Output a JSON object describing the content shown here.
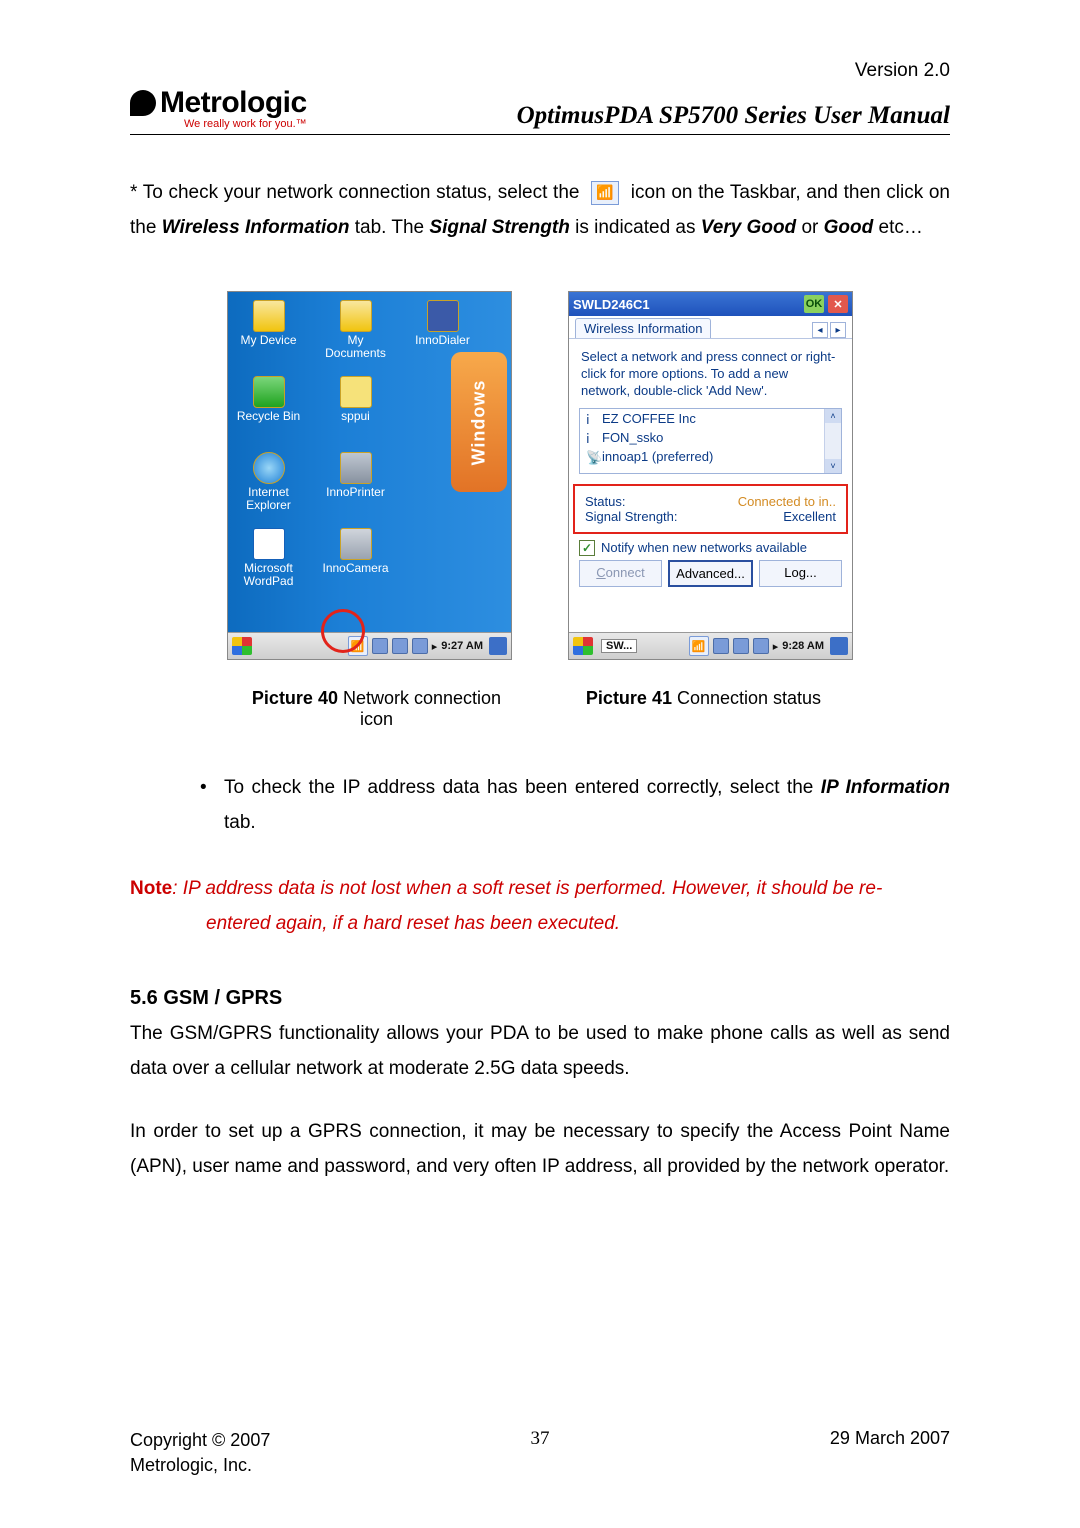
{
  "version_label": "Version 2.0",
  "logo": {
    "name": "Metrologic",
    "tagline": "We really work for you.™"
  },
  "doc_title": "OptimusPDA SP5700 Series User Manual",
  "para1": {
    "t1": "*  To check your network connection status, select the ",
    "t2": " icon on the Taskbar, and then click on the ",
    "wi": "Wireless Information",
    "t3": " tab. The ",
    "ss": "Signal Strength",
    "t4": " is indicated as ",
    "vg": "Very Good",
    "t5": " or ",
    "gd": "Good",
    "t6": " etc…"
  },
  "desktop": {
    "icons": [
      "My Device",
      "My Documents",
      "InnoDialer",
      "Recycle Bin",
      "sppui",
      "Internet Explorer",
      "InnoPrinter",
      "Microsoft WordPad",
      "InnoCamera"
    ],
    "clock": "9:27 AM"
  },
  "wireless": {
    "title": "SWLD246C1",
    "ok": "OK",
    "close": "✕",
    "tab": "Wireless Information",
    "help": "Select a network and press connect or right-click for more options.  To add a new network, double-click 'Add New'.",
    "nets": [
      "EZ COFFEE Inc",
      "FON_ssko",
      "innoap1 (preferred)"
    ],
    "status_lbl": "Status:",
    "status_val": "Connected to in..",
    "strength_lbl": "Signal Strength:",
    "strength_val": "Excellent",
    "notify": "Notify when new networks available",
    "btn_connect": "Connect",
    "btn_advanced": "Advanced...",
    "btn_log": "Log...",
    "taskbar_app": "SW...",
    "clock": "9:28 AM"
  },
  "captions": {
    "c1b": "Picture 40 ",
    "c1": "Network connection icon",
    "c2b": "Picture 41 ",
    "c2": "Connection status"
  },
  "bullet": {
    "t1": "To check the IP address data has been entered correctly, select the ",
    "ip": "IP Information",
    "t2": " tab."
  },
  "note": {
    "label": "Note",
    "colon": ": ",
    "line1": "IP address data is not lost when a soft reset is performed. However, it should be re-",
    "line2": "entered again, if a hard reset has been executed."
  },
  "section": "5.6 GSM / GPRS",
  "p2": "The GSM/GPRS functionality allows your PDA to be used to make phone calls as well as send data over a cellular network at moderate 2.5G data speeds.",
  "p3": "In order to set up a GPRS connection, it may be necessary to specify the Access Point Name (APN), user name and password, and very often IP address, all provided by the network operator.",
  "footer": {
    "copy1": "Copyright © 2007",
    "copy2": "Metrologic, Inc.",
    "page": "37",
    "date": "29 March 2007"
  }
}
